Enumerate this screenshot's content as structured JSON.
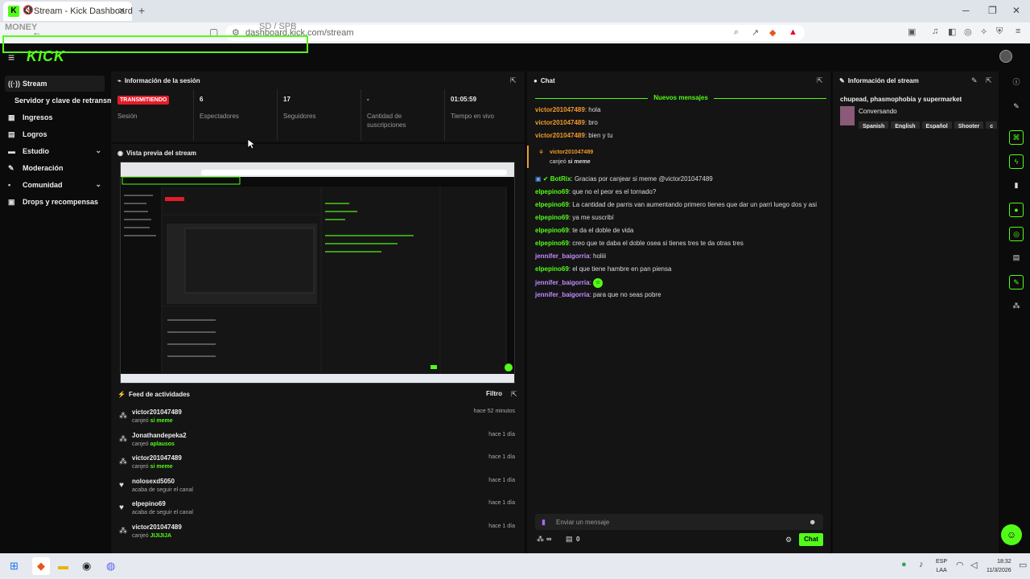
{
  "browser": {
    "tab_title": "Stream - Kick Dashboard",
    "tab_favicon": "K",
    "url": "dashboard.kick.com/stream",
    "overlay_text": "MONEY",
    "watermark": "SD / SPB"
  },
  "header": {
    "logo": "KICK"
  },
  "sidebar": {
    "items": [
      {
        "label": "Stream",
        "icon": "stream-icon",
        "glyph": "((·))"
      },
      {
        "label": "Servidor y clave de retransmisión",
        "icon": "",
        "glyph": ""
      },
      {
        "label": "Ingresos",
        "icon": "income-icon",
        "glyph": "▦"
      },
      {
        "label": "Logros",
        "icon": "achievements-icon",
        "glyph": "▤"
      },
      {
        "label": "Estudio",
        "icon": "studio-icon",
        "glyph": "▬"
      },
      {
        "label": "Moderación",
        "icon": "moderation-icon",
        "glyph": "✎"
      },
      {
        "label": "Comunidad",
        "icon": "community-icon",
        "glyph": "▪"
      },
      {
        "label": "Drops y recompensas",
        "icon": "drops-icon",
        "glyph": "▣"
      }
    ]
  },
  "session": {
    "title": "Información de la sesión",
    "status_badge": "TRANSMITIENDO",
    "status_label": "Sesión",
    "viewers_value": "6",
    "viewers_label": "Espectadores",
    "followers_value": "17",
    "followers_label": "Seguidores",
    "subs_value": "-",
    "subs_label": "Cantidad de suscripciones",
    "live_value": "01:05:59",
    "live_label": "Tiempo en vivo"
  },
  "preview": {
    "title": "Vista previa del stream"
  },
  "activity": {
    "title": "Feed de actividades",
    "filter": "Filtro",
    "items": [
      {
        "user": "victor201047489",
        "action": "canjeó",
        "reward": "si meme",
        "time": "hace 52 minutos",
        "icon": "reward-icon"
      },
      {
        "user": "Jonathandepeka2",
        "action": "canjeó",
        "reward": "aplausos",
        "time": "hace 1 día",
        "icon": "reward-icon"
      },
      {
        "user": "victor201047489",
        "action": "canjeó",
        "reward": "si meme",
        "time": "hace 1 día",
        "icon": "reward-icon"
      },
      {
        "user": "nolosexd5050",
        "action": "acaba de seguir el canal",
        "reward": "",
        "time": "hace 1 día",
        "icon": "heart-icon"
      },
      {
        "user": "elpepino69",
        "action": "acaba de seguir el canal",
        "reward": "",
        "time": "hace 1 día",
        "icon": "heart-icon"
      },
      {
        "user": "victor201047489",
        "action": "canjeó",
        "reward": "JIJIJIJA",
        "time": "hace 1 día",
        "icon": "reward-icon"
      }
    ]
  },
  "chat": {
    "title": "Chat",
    "new_messages": "Nuevos mensajes",
    "messages": [
      {
        "user": "victor201047489",
        "text": ": hola",
        "color": "or"
      },
      {
        "user": "victor201047489",
        "text": ": bro",
        "color": "or"
      },
      {
        "user": "victor201047489",
        "text": ": bien y tu",
        "color": "or"
      },
      {
        "user": "BotRix",
        "text": ": Gracias por canjear si meme @victor201047489",
        "color": "gr"
      },
      {
        "user": "elpepino69",
        "text": ": que no el peor es el tornado?",
        "color": "gr"
      },
      {
        "user": "elpepino69",
        "text": ": La cantidad de parris van aumentando primero tienes que dar un parri luego dos y asi",
        "color": "gr"
      },
      {
        "user": "elpepino69",
        "text": ": ya me suscribí",
        "color": "gr"
      },
      {
        "user": "elpepino69",
        "text": ": te da el doble de vida",
        "color": "gr"
      },
      {
        "user": "elpepino69",
        "text": ": creo que te daba el doble osea si tienes tres te da otras tres",
        "color": "gr"
      },
      {
        "user": "jennifer_baigorria",
        "text": ": holiii",
        "color": "pu"
      },
      {
        "user": "elpepino69",
        "text": ": el que tiene hambre en pan piensa",
        "color": "gr"
      },
      {
        "user": "jennifer_baigorria",
        "text": ":",
        "color": "pu"
      },
      {
        "user": "jennifer_baigorria",
        "text": ": para que no seas pobre",
        "color": "pu"
      }
    ],
    "redeem_user": "victor201047489",
    "redeem_action": "canjeó",
    "redeem_reward": "si meme",
    "input_placeholder": "Enviar un mensaje",
    "points_value": "∞",
    "gifts_value": "0",
    "send_label": "Chat"
  },
  "stream_info": {
    "title": "Información del stream",
    "stream_title": "chupead, phasmophobia y supermarket",
    "category": "Conversando",
    "tags": [
      "Spanish",
      "English",
      "Español",
      "Shooter",
      "c"
    ]
  },
  "taskbar": {
    "lang_line1": "ESP",
    "lang_line2": "LAA",
    "time": "18:32",
    "date": "11/3/2026"
  },
  "colors": {
    "accent": "#53fc18",
    "live": "#e11d2a",
    "panel": "#141414"
  }
}
